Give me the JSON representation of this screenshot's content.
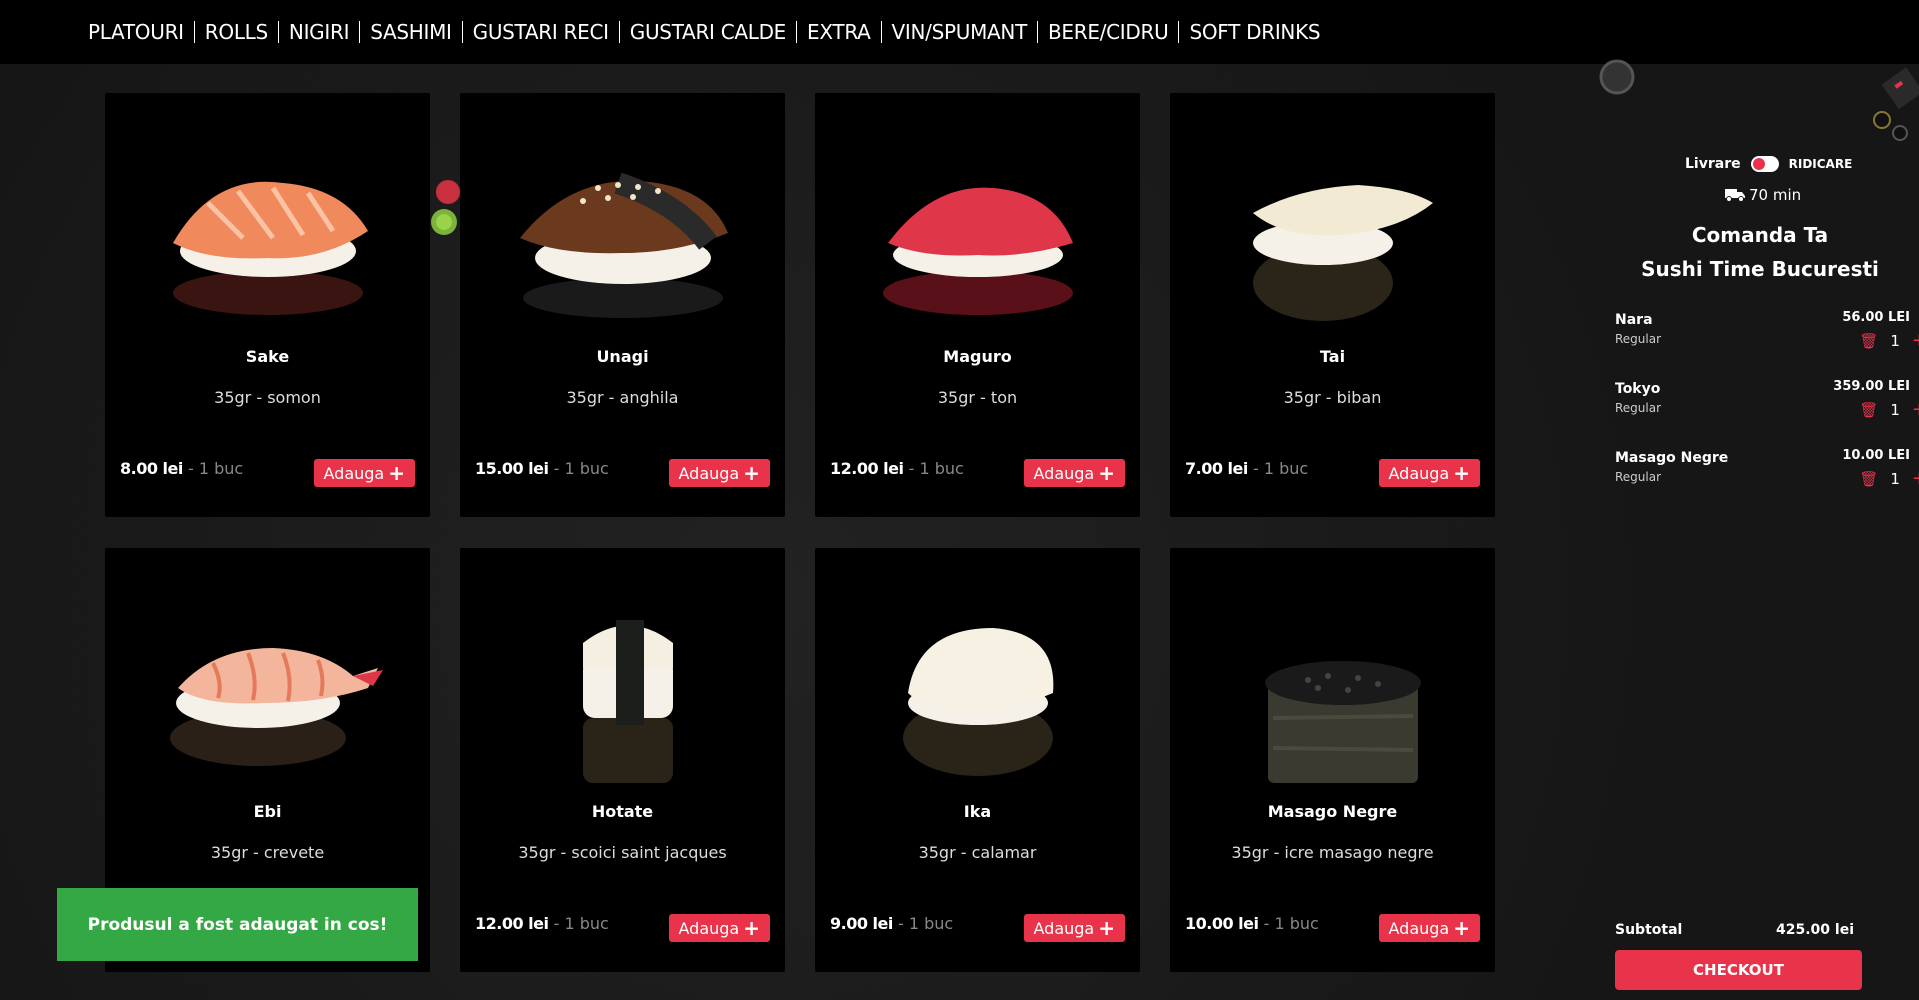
{
  "nav": {
    "items": [
      "PLATOURI",
      "ROLLS",
      "NIGIRI",
      "SASHIMI",
      "GUSTARI RECI",
      "GUSTARI CALDE",
      "EXTRA",
      "VIN/SPUMANT",
      "BERE/CIDRU",
      "SOFT DRINKS"
    ]
  },
  "products": [
    {
      "name": "Sake",
      "desc": "35gr - somon",
      "price": "8.00 lei",
      "unit": " - 1 buc",
      "add": "Adauga",
      "color": "#f08a5d"
    },
    {
      "name": "Unagi",
      "desc": "35gr - anghila",
      "price": "15.00 lei",
      "unit": " - 1 buc",
      "add": "Adauga",
      "color": "#6b3a1e"
    },
    {
      "name": "Maguro",
      "desc": "35gr - ton",
      "price": "12.00 lei",
      "unit": " - 1 buc",
      "add": "Adauga",
      "color": "#e0364a"
    },
    {
      "name": "Tai",
      "desc": "35gr - biban",
      "price": "7.00 lei",
      "unit": " - 1 buc",
      "add": "Adauga",
      "color": "#f2ead2"
    },
    {
      "name": "Ebi",
      "desc": "35gr - crevete",
      "price": "",
      "unit": "",
      "add": "",
      "color": "#f3b59c"
    },
    {
      "name": "Hotate",
      "desc": "35gr - scoici saint jacques",
      "price": "12.00 lei",
      "unit": " - 1 buc",
      "add": "Adauga",
      "color": "#f5efe2"
    },
    {
      "name": "Ika",
      "desc": "35gr - calamar",
      "price": "9.00 lei",
      "unit": " - 1 buc",
      "add": "Adauga",
      "color": "#f6f1e3"
    },
    {
      "name": "Masago Negre",
      "desc": "35gr - icre masago negre",
      "price": "10.00 lei",
      "unit": " - 1 buc",
      "add": "Adauga",
      "color": "#2a2a22"
    }
  ],
  "sidebar": {
    "livrare": "Livrare",
    "ridicare": "RIDICARE",
    "time": "70 min",
    "title_line1": "Comanda Ta",
    "title_line2": "Sushi Time Bucuresti",
    "cart": [
      {
        "name": "Nara",
        "variant": "Regular",
        "price": "56.00 LEI",
        "qty": "1"
      },
      {
        "name": "Tokyo",
        "variant": "Regular",
        "price": "359.00 LEI",
        "qty": "1"
      },
      {
        "name": "Masago Negre",
        "variant": "Regular",
        "price": "10.00 LEI",
        "qty": "1"
      }
    ],
    "subtotal_label": "Subtotal",
    "subtotal_value": "425.00 lei",
    "checkout": "CHECKOUT"
  },
  "toast": "Produsul a fost adaugat in cos!",
  "colors": {
    "accent": "#e8334a",
    "toast": "#34a845"
  }
}
